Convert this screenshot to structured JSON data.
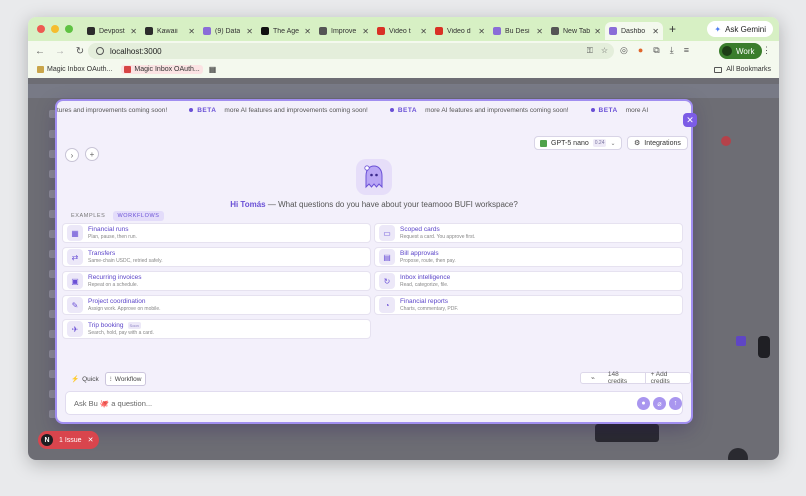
{
  "browser": {
    "tabs": [
      {
        "title": "Devpost",
        "color": "#2c2c2c"
      },
      {
        "title": "Kawaii",
        "color": "#2c2c2c"
      },
      {
        "title": "(9) Data",
        "color": "#8a6cd8"
      },
      {
        "title": "The Age",
        "color": "#111111"
      },
      {
        "title": "Improve",
        "color": "#555555"
      },
      {
        "title": "Video t",
        "color": "#d93025"
      },
      {
        "title": "Video d",
        "color": "#d93025"
      },
      {
        "title": "Bu Desi",
        "color": "#8a6cd8"
      },
      {
        "title": "New Tab",
        "color": "#555555"
      },
      {
        "title": "Dashbo",
        "color": "#8a6cd8"
      }
    ],
    "new_tab_glyph": "+",
    "ask_gemini": "Ask Gemini",
    "url": "localhost:3000",
    "profile": "Work",
    "bookmarks": [
      "Magic Inbox OAuth...",
      "Magic Inbox OAuth..."
    ],
    "all_bookmarks": "All Bookmarks"
  },
  "modal": {
    "marquee": [
      {
        "text": "tures and improvements coming soon!"
      },
      {
        "badge": "BETA",
        "text": "more AI features and improvements coming soon!"
      },
      {
        "badge": "BETA",
        "text": "more AI features and improvements coming soon!"
      },
      {
        "badge": "BETA",
        "text": "more AI"
      }
    ],
    "model": {
      "name": "GPT-5 nano",
      "badge": "0.24"
    },
    "integrations": "Integrations",
    "greeting": {
      "hi": "Hi Tomás",
      "dash": "—",
      "question": "What questions do you have about your teamooo BUFI workspace?"
    },
    "section_tabs": [
      "EXAMPLES",
      "WORKFLOWS"
    ],
    "cards": [
      {
        "title": "Financial runs",
        "sub": "Plan, pause, then run.",
        "icon": "chart-icon",
        "glyph": "▦"
      },
      {
        "title": "Scoped cards",
        "sub": "Request a card. You approve first.",
        "icon": "card-icon",
        "glyph": "▭"
      },
      {
        "title": "Transfers",
        "sub": "Same-chain USDC, retried safely.",
        "icon": "transfer-icon",
        "glyph": "⇄"
      },
      {
        "title": "Bill approvals",
        "sub": "Propose, route, then pay.",
        "icon": "bill-icon",
        "glyph": "▤"
      },
      {
        "title": "Recurring invoices",
        "sub": "Repeat on a schedule.",
        "icon": "invoice-icon",
        "glyph": "▣"
      },
      {
        "title": "Inbox intelligence",
        "sub": "Read, categorize, file.",
        "icon": "inbox-icon",
        "glyph": "↻"
      },
      {
        "title": "Project coordination",
        "sub": "Assign work. Approve on mobile.",
        "icon": "project-icon",
        "glyph": "✎"
      },
      {
        "title": "Financial reports",
        "sub": "Charts, commentary, PDF.",
        "icon": "report-icon",
        "glyph": "◔"
      },
      {
        "title": "Trip booking",
        "sub": "Search, hold, pay with a card.",
        "icon": "trip-icon",
        "glyph": "✈",
        "badge": "Soon"
      }
    ],
    "modes": [
      "Quick",
      "Workflow"
    ],
    "credits": "148 credits",
    "add_credits": "+ Add credits",
    "input_placeholder": "Ask Bu 🐙 a question..."
  },
  "issue": {
    "badge": "N",
    "label": "1 Issue"
  },
  "colors": {
    "accent": "#6a50d6",
    "tabstrip": "#d7f0c4",
    "issue": "#d9454d"
  }
}
